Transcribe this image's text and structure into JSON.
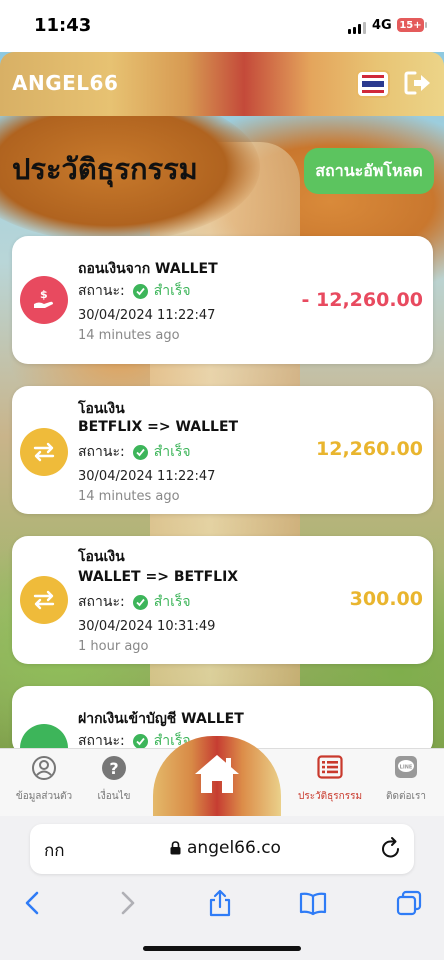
{
  "status_bar": {
    "time": "11:43",
    "network": "4G",
    "battery": "15+"
  },
  "header": {
    "brand": "ANGEL66",
    "language_flag": "thailand-flag-icon",
    "logout_icon": "logout-icon"
  },
  "page": {
    "title": "ประวัติธุรกรรม",
    "download_status_label": "สถานะอัพโหลด"
  },
  "transactions": [
    {
      "type_icon": "withdraw-hand-dollar-icon",
      "title": "ถอนเงินจาก WALLET",
      "subtitle": "",
      "status_label": "สถานะ:",
      "status_value": "สำเร็จ",
      "datetime": "30/04/2024 11:22:47",
      "ago": "14 minutes ago",
      "amount": "- 12,260.00",
      "color": "#e84a5f"
    },
    {
      "type_icon": "transfer-arrows-icon",
      "title": "โอนเงิน",
      "subtitle": "BETFLIX => WALLET",
      "status_label": "สถานะ:",
      "status_value": "สำเร็จ",
      "datetime": "30/04/2024 11:22:47",
      "ago": "14 minutes ago",
      "amount": "12,260.00",
      "color": "#efbb3a"
    },
    {
      "type_icon": "transfer-arrows-icon",
      "title": "โอนเงิน",
      "subtitle": "WALLET => BETFLIX",
      "status_label": "สถานะ:",
      "status_value": "สำเร็จ",
      "datetime": "30/04/2024 10:31:49",
      "ago": "1 hour ago",
      "amount": "300.00",
      "color": "#efbb3a"
    },
    {
      "type_icon": "deposit-icon",
      "title": "ฝากเงินเข้าบัญชี WALLET",
      "subtitle": "",
      "status_label": "สถานะ:",
      "status_value": "สำเร็จ",
      "color": "#3db55a"
    }
  ],
  "bottom_nav": {
    "items": [
      {
        "label": "ข้อมูลส่วนตัว",
        "icon": "user-circle-icon"
      },
      {
        "label": "เงื่อนไข",
        "icon": "question-circle-icon"
      },
      {
        "label": "",
        "icon": "home-icon"
      },
      {
        "label": "ประวัติธุรกรรม",
        "icon": "list-icon",
        "active": true
      },
      {
        "label": "ติดต่อเรา",
        "icon": "line-chat-icon"
      }
    ],
    "active_color": "#c9392c"
  },
  "browser": {
    "aa_label": "กก",
    "url": "angel66.co"
  }
}
